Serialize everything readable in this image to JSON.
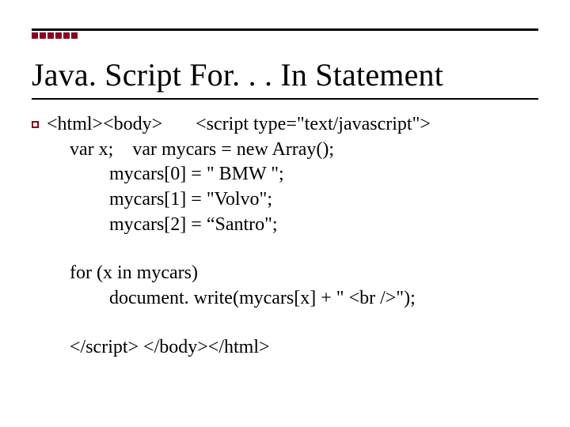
{
  "title": "Java. Script For. . . In Statement",
  "code": {
    "l1": "<html><body>       <script type=\"text/javascript\">",
    "l2": "var x;    var mycars = new Array();",
    "l3": "mycars[0] = \" BMW \";",
    "l4": "mycars[1] = \"Volvo\";",
    "l5": "mycars[2] = “Santro\";",
    "l6": "for (x in mycars)",
    "l7": "document. write(mycars[x] + \" <br />\");",
    "l8": "</script> </body></html>"
  }
}
